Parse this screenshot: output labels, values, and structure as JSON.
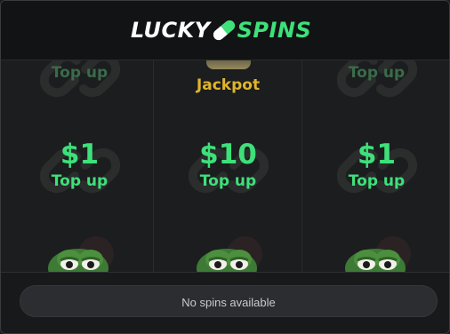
{
  "header": {
    "logo_left": "LUCKY",
    "logo_right": "SPINS"
  },
  "reels": [
    {
      "top_label": "Top up",
      "center_amount": "$1",
      "center_label": "Top up"
    },
    {
      "top_label": "Jackpot",
      "center_amount": "$10",
      "center_label": "Top up"
    },
    {
      "top_label": "Top up",
      "center_amount": "$1",
      "center_label": "Top up"
    }
  ],
  "footer": {
    "spin_button_label": "No spins available"
  },
  "colors": {
    "accent_green": "#3ee07a",
    "jackpot_gold": "#e0b52a",
    "background": "#1d1e20",
    "header_bg": "#121314"
  },
  "icons": [
    "pill-icon",
    "chain-link-icon",
    "frog-icon"
  ]
}
